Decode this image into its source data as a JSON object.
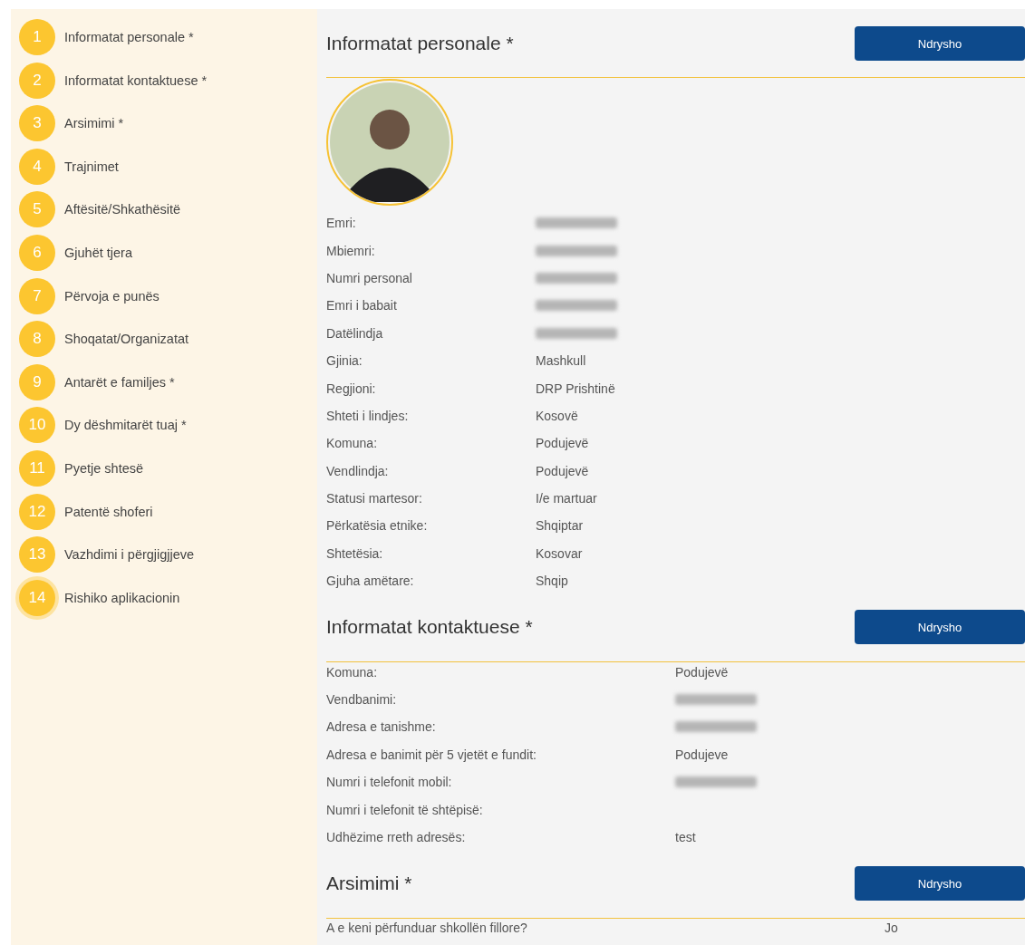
{
  "sidebar": {
    "steps": [
      {
        "number": "1",
        "label": "Informatat personale *",
        "selected": false
      },
      {
        "number": "2",
        "label": "Informatat kontaktuese *",
        "selected": false
      },
      {
        "number": "3",
        "label": "Arsimimi *",
        "selected": false
      },
      {
        "number": "4",
        "label": "Trajnimet",
        "selected": false
      },
      {
        "number": "5",
        "label": "Aftësitë/Shkathësitë",
        "selected": false
      },
      {
        "number": "6",
        "label": "Gjuhët tjera",
        "selected": false
      },
      {
        "number": "7",
        "label": "Përvoja e punës",
        "selected": false
      },
      {
        "number": "8",
        "label": "Shoqatat/Organizatat",
        "selected": false
      },
      {
        "number": "9",
        "label": "Antarët e familjes *",
        "selected": false
      },
      {
        "number": "10",
        "label": "Dy dëshmitarët tuaj *",
        "selected": false
      },
      {
        "number": "11",
        "label": "Pyetje shtesë",
        "selected": false
      },
      {
        "number": "12",
        "label": "Patentë shoferi",
        "selected": false
      },
      {
        "number": "13",
        "label": "Vazhdimi i përgjigjjeve",
        "selected": false
      },
      {
        "number": "14",
        "label": "Rishiko aplikacionin",
        "selected": true
      }
    ]
  },
  "sections": [
    {
      "kind": "profile",
      "title": "Informatat personale *",
      "button": "Ndrysho",
      "photo": true,
      "fields": [
        {
          "label": "Emri:",
          "redacted": true
        },
        {
          "label": "Mbiemri:",
          "redacted": true
        },
        {
          "label": "Numri personal",
          "redacted": true
        },
        {
          "label": "Emri i babait",
          "redacted": true
        },
        {
          "label": "Datëlindja",
          "redacted": true
        },
        {
          "label": "Gjinia:",
          "value": "Mashkull"
        },
        {
          "label": "Regjioni:",
          "value": "DRP Prishtinë"
        },
        {
          "label": "Shteti i lindjes:",
          "value": "Kosovë"
        },
        {
          "label": "Komuna:",
          "value": "Podujevë"
        },
        {
          "label": "Vendlindja:",
          "value": "Podujevë"
        },
        {
          "label": "Statusi martesor:",
          "value": "I/e martuar"
        },
        {
          "label": "Përkatësia etnike:",
          "value": "Shqiptar"
        },
        {
          "label": "Shtetësia:",
          "value": "Kosovar"
        },
        {
          "label": "Gjuha amëtare:",
          "value": "Shqip"
        }
      ]
    },
    {
      "kind": "contact",
      "title": "Informatat kontaktuese *",
      "button": "Ndrysho",
      "fields": [
        {
          "label": "Komuna:",
          "value": "Podujevë"
        },
        {
          "label": "Vendbanimi:",
          "redacted": true
        },
        {
          "label": "Adresa e tanishme:",
          "redacted": true
        },
        {
          "label": "Adresa e banimit për 5 vjetët e fundit:",
          "value": "Podujeve"
        },
        {
          "label": "Numri i telefonit mobil:",
          "redacted": true
        },
        {
          "label": "Numri i telefonit të shtëpisë:"
        },
        {
          "label": "Udhëzime rreth adresës:",
          "value": "test"
        }
      ]
    },
    {
      "kind": "questions",
      "title": "Arsimimi *",
      "button": "Ndrysho",
      "fields": [
        {
          "label": "A e keni përfunduar shkollën fillore?",
          "value": "Jo"
        }
      ]
    }
  ]
}
